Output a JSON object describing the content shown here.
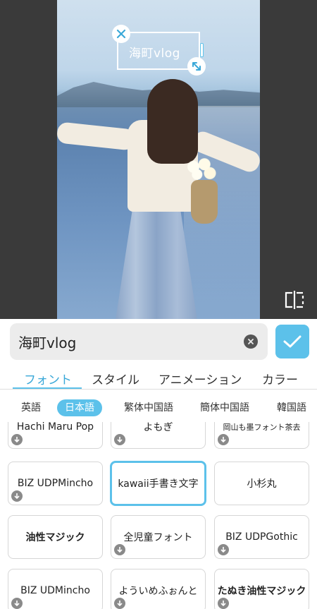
{
  "overlay": {
    "text": "海町vlog"
  },
  "input": {
    "value": "海町vlog"
  },
  "main_tabs": [
    "フォント",
    "スタイル",
    "アニメーション",
    "カラー"
  ],
  "languages": [
    "英語",
    "日本語",
    "繁体中国語",
    "簡体中国語",
    "韓国語"
  ],
  "fonts": [
    {
      "label": "Hachi Maru Pop",
      "download": true
    },
    {
      "label": "よもぎ",
      "download": true
    },
    {
      "label": "岡山も墨フォント茶去",
      "download": true
    },
    {
      "label": "BIZ UDPMincho",
      "download": true
    },
    {
      "label": "kawaii手書き文字",
      "download": false
    },
    {
      "label": "小杉丸",
      "download": false
    },
    {
      "label": "油性マジック",
      "download": false
    },
    {
      "label": "全児童フォント",
      "download": true
    },
    {
      "label": "BIZ UDPGothic",
      "download": true
    },
    {
      "label": "BIZ UDMincho",
      "download": true
    },
    {
      "label": "よういめふぉんと",
      "download": true
    },
    {
      "label": "たぬき油性マジック",
      "download": true
    }
  ],
  "colors": {
    "accent": "#5cc1ea",
    "tab_active": "#3aa8d8",
    "preview_bg": "#3a3a3a"
  }
}
